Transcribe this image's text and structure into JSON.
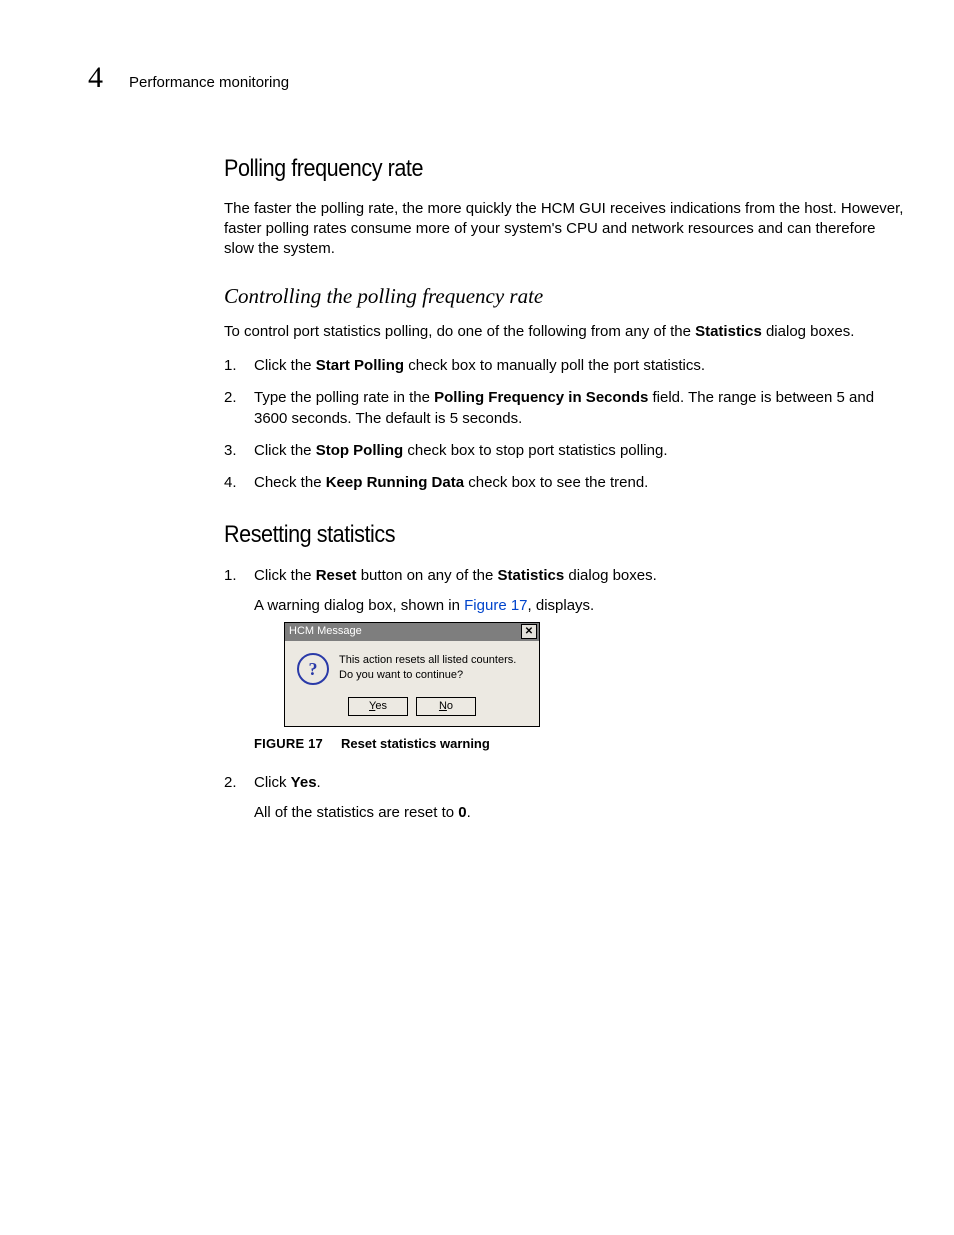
{
  "header": {
    "chapter": "4",
    "section": "Performance monitoring"
  },
  "h1": "Polling frequency rate",
  "p1": "The faster the polling rate, the more quickly the HCM GUI receives indications from the host. However, faster polling rates consume more of your system's CPU and network resources and can therefore slow the system.",
  "h2": "Controlling the polling frequency rate",
  "p2_a": "To control port statistics polling, do one of the following from any of the ",
  "p2_bold": "Statistics",
  "p2_b": " dialog boxes.",
  "steps_a": [
    {
      "n": "1.",
      "pre": "Click the ",
      "bold": "Start Polling",
      "post": " check box to manually poll the port statistics."
    },
    {
      "n": "2.",
      "pre": "Type the polling rate in the ",
      "bold": "Polling Frequency in Seconds",
      "post": " field. The range is between 5 and 3600 seconds. The default is 5 seconds."
    },
    {
      "n": "3.",
      "pre": "Click the ",
      "bold": "Stop Polling",
      "post": " check box to stop port statistics polling."
    },
    {
      "n": "4.",
      "pre": "Check the ",
      "bold": "Keep Running Data",
      "post": " check box to see the trend."
    }
  ],
  "h3": "Resetting statistics",
  "reset": {
    "n1": "1.",
    "s1_pre": "Click the ",
    "s1_b1": "Reset",
    "s1_mid": " button on any of the ",
    "s1_b2": "Statistics",
    "s1_post": " dialog boxes.",
    "s1_sub_a": "A warning dialog box, shown in ",
    "s1_link": "Figure 17",
    "s1_sub_b": ", displays.",
    "n2": "2.",
    "s2_pre": "Click ",
    "s2_bold": "Yes",
    "s2_post": ".",
    "s2_sub_a": "All of the statistics are reset to ",
    "s2_bold2": "0",
    "s2_sub_b": "."
  },
  "dialog": {
    "title": "HCM Message",
    "line1": "This action resets all listed counters.",
    "line2": "Do you want to continue?",
    "yes_u": "Y",
    "yes_r": "es",
    "no_u": "N",
    "no_r": "o"
  },
  "figure": {
    "label": "FIGURE 17",
    "caption": "Reset statistics warning"
  }
}
